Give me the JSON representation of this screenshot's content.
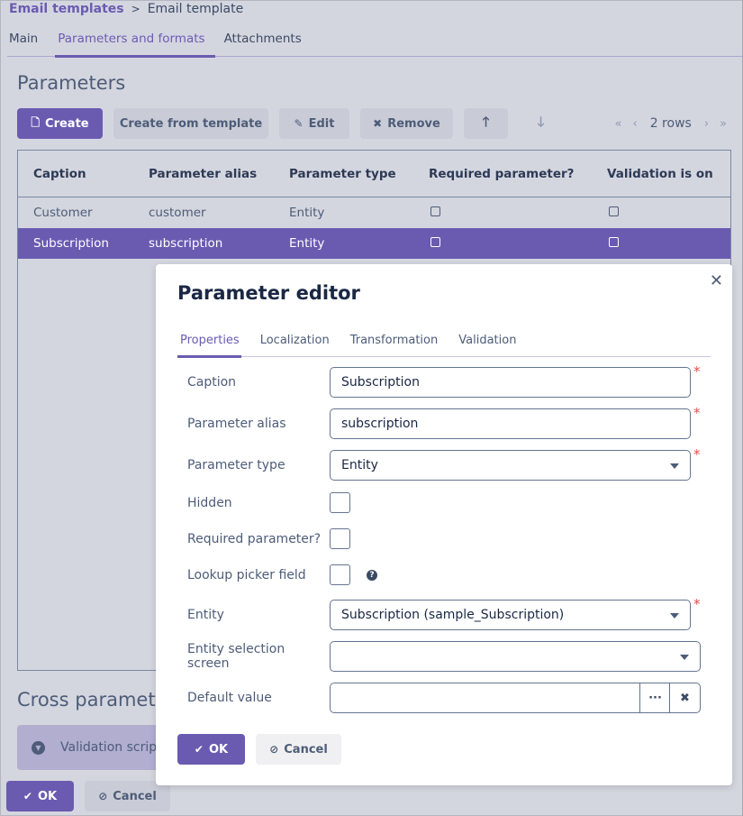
{
  "breadcrumb": {
    "parent": "Email templates",
    "separator": ">",
    "current": "Email template"
  },
  "tabs": [
    {
      "label": "Main",
      "active": false
    },
    {
      "label": "Parameters and formats",
      "active": true
    },
    {
      "label": "Attachments",
      "active": false
    }
  ],
  "parameters": {
    "title": "Parameters",
    "toolbar": {
      "create": "Create",
      "create_from_template": "Create from template",
      "edit": "Edit",
      "remove": "Remove",
      "move_up_icon": "arrow-up-icon",
      "move_down_icon": "arrow-down-icon"
    },
    "pager": {
      "first": "«",
      "prev": "‹",
      "rows": "2 rows",
      "next": "›",
      "last": "»"
    },
    "table": {
      "columns": [
        "Caption",
        "Parameter alias",
        "Parameter type",
        "Required parameter?",
        "Validation is on"
      ],
      "rows": [
        {
          "caption": "Customer",
          "alias": "customer",
          "type": "Entity",
          "required": false,
          "validation": false,
          "selected": false
        },
        {
          "caption": "Subscription",
          "alias": "subscription",
          "type": "Entity",
          "required": false,
          "validation": false,
          "selected": true
        }
      ]
    }
  },
  "cross_parameters": {
    "title": "Cross parameter",
    "validation_script_label": "Validation script"
  },
  "footer": {
    "ok": "OK",
    "cancel": "Cancel"
  },
  "dialog": {
    "title": "Parameter editor",
    "close_icon": "close-icon",
    "tabs": [
      {
        "label": "Properties",
        "active": true
      },
      {
        "label": "Localization",
        "active": false
      },
      {
        "label": "Transformation",
        "active": false
      },
      {
        "label": "Validation",
        "active": false
      }
    ],
    "fields": {
      "caption": {
        "label": "Caption",
        "value": "Subscription",
        "required": true
      },
      "alias": {
        "label": "Parameter alias",
        "value": "subscription",
        "required": true
      },
      "type": {
        "label": "Parameter type",
        "value": "Entity",
        "required": true
      },
      "hidden": {
        "label": "Hidden",
        "checked": false
      },
      "required_param": {
        "label": "Required parameter?",
        "checked": false
      },
      "lookup_picker": {
        "label": "Lookup picker field",
        "checked": false,
        "help": "?"
      },
      "entity": {
        "label": "Entity",
        "value": "Subscription (sample_Subscription)",
        "required": true
      },
      "entity_screen": {
        "label": "Entity selection screen",
        "value": ""
      },
      "default_value": {
        "label": "Default value",
        "value": "",
        "picker_label": "···",
        "clear_label": "✖"
      }
    },
    "required_mark": "*",
    "ok": "OK",
    "cancel": "Cancel"
  },
  "colors": {
    "accent": "#6a5bb1",
    "background": "#d4d6df",
    "required": "#e84c4c"
  }
}
